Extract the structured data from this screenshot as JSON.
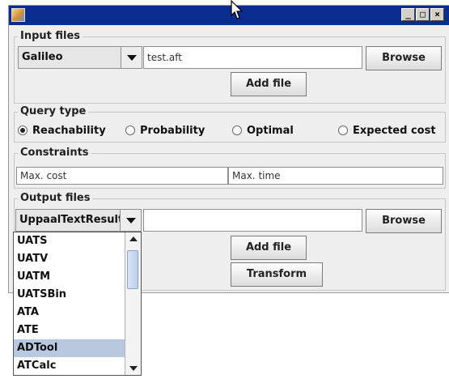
{
  "window": {
    "controls": [
      "_",
      "□",
      "×"
    ]
  },
  "input_files": {
    "title": "Input files",
    "format_value": "Galileo",
    "file_value": "test.aft",
    "browse_label": "Browse",
    "add_file_label": "Add file"
  },
  "query_type": {
    "title": "Query type",
    "options": [
      {
        "label": "Reachability",
        "checked": true
      },
      {
        "label": "Probability",
        "checked": false
      },
      {
        "label": "Optimal",
        "checked": false
      },
      {
        "label": "Expected cost",
        "checked": false
      }
    ]
  },
  "constraints": {
    "title": "Constraints",
    "max_cost_placeholder": "Max. cost",
    "max_time_placeholder": "Max. time"
  },
  "output_files": {
    "title": "Output files",
    "format_value": "UppaalTextResult",
    "file_value": "",
    "browse_label": "Browse",
    "add_file_label": "Add file",
    "transform_label": "Transform"
  },
  "dropdown": {
    "items": [
      "UATS",
      "UATV",
      "UATM",
      "UATSBin",
      "ATA",
      "ATE",
      "ADTool",
      "ATCalc"
    ],
    "selected": "ADTool"
  },
  "icons": {
    "app": "java-app-icon",
    "cursor": "mouse-cursor-icon"
  }
}
